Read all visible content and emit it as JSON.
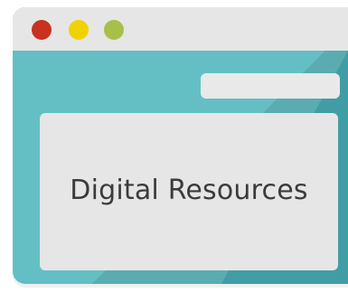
{
  "window": {
    "controls": [
      {
        "name": "close",
        "color": "#c8321e"
      },
      {
        "name": "minimize",
        "color": "#f0d200"
      },
      {
        "name": "maximize",
        "color": "#a8bf4a"
      }
    ],
    "colors": {
      "titlebar": "#e6e6e6",
      "body": "#64bfc4",
      "shadow": "#3d9aa3",
      "panel": "#e6e6e6"
    }
  },
  "content": {
    "title": "Digital Resources"
  }
}
